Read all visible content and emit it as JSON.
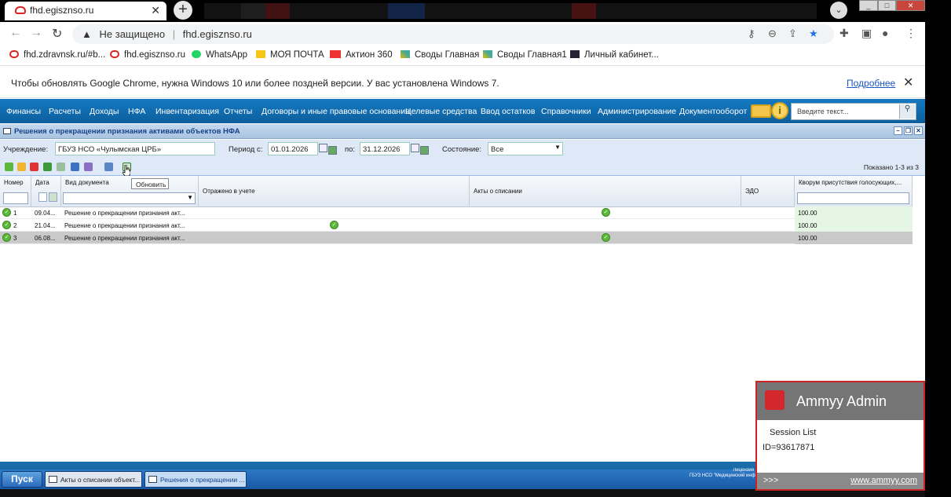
{
  "browser": {
    "tab_title": "fhd.egisznso.ru",
    "new_tab": "+",
    "not_secure": "Не защищено",
    "url": "fhd.egisznso.ru",
    "bookmarks": [
      "fhd.zdravnsk.ru/#b...",
      "fhd.egisznso.ru",
      "WhatsApp",
      "МОЯ ПОЧТА",
      "Актион 360",
      "Своды Главная",
      "Своды Главная1",
      "Личный кабинет..."
    ],
    "info_text": "Чтобы обновлять Google Chrome, нужна Windows 10 или более поздней версии. У вас установлена Windows 7.",
    "info_link": "Подробнее"
  },
  "menu": {
    "items": [
      "Финансы",
      "Расчеты",
      "Доходы",
      "НФА",
      "Инвентаризация",
      "Отчеты",
      "Договоры и иные правовые основания",
      "Целевые средства",
      "Ввод остатков",
      "Справочники",
      "Администрирование",
      "Документооборот"
    ],
    "search_placeholder": "Введите текст..."
  },
  "window": {
    "title": "Решения о прекращении признания активами объектов НФА"
  },
  "filter": {
    "institution_label": "Учреждение:",
    "institution_value": "ГБУЗ НСО «Чулымская ЦРБ»",
    "period_from_label": "Период с:",
    "period_from": "01.01.2026",
    "period_to_label": "по:",
    "period_to": "31.12.2026",
    "state_label": "Состояние:",
    "state_value": "Все"
  },
  "toolbar": {
    "shown": "Показано 1-3 из 3",
    "tooltip": "Обновить"
  },
  "grid": {
    "columns": [
      "Номер",
      "Дата",
      "Вид документа",
      "Отражено в учете",
      "Акты о списании",
      "ЭДО",
      "Кворум присутствия голосующих,..."
    ],
    "rows": [
      {
        "num": "1",
        "date": "09.04...",
        "kind": "Решение о прекращении признания акт...",
        "quorum": "100.00"
      },
      {
        "num": "2",
        "date": "21.04...",
        "kind": "Решение о прекращении признания акт...",
        "quorum": "100.00"
      },
      {
        "num": "3",
        "date": "06.08...",
        "kind": "Решение о прекращении признания акт...",
        "quorum": "100.00"
      }
    ]
  },
  "taskbar": {
    "start": "Пуск",
    "tasks": [
      "Акты о списании объект...",
      "Решения о прекращении ..."
    ],
    "license_1": "Лицензия н",
    "license_2": "ГБУЗ НСО \"Медицинский инфо"
  },
  "ammyy": {
    "title": "Ammyy Admin",
    "session_list": "Session List",
    "id": "ID=93617871",
    "more": ">>>",
    "url": "www.ammyy.com"
  }
}
